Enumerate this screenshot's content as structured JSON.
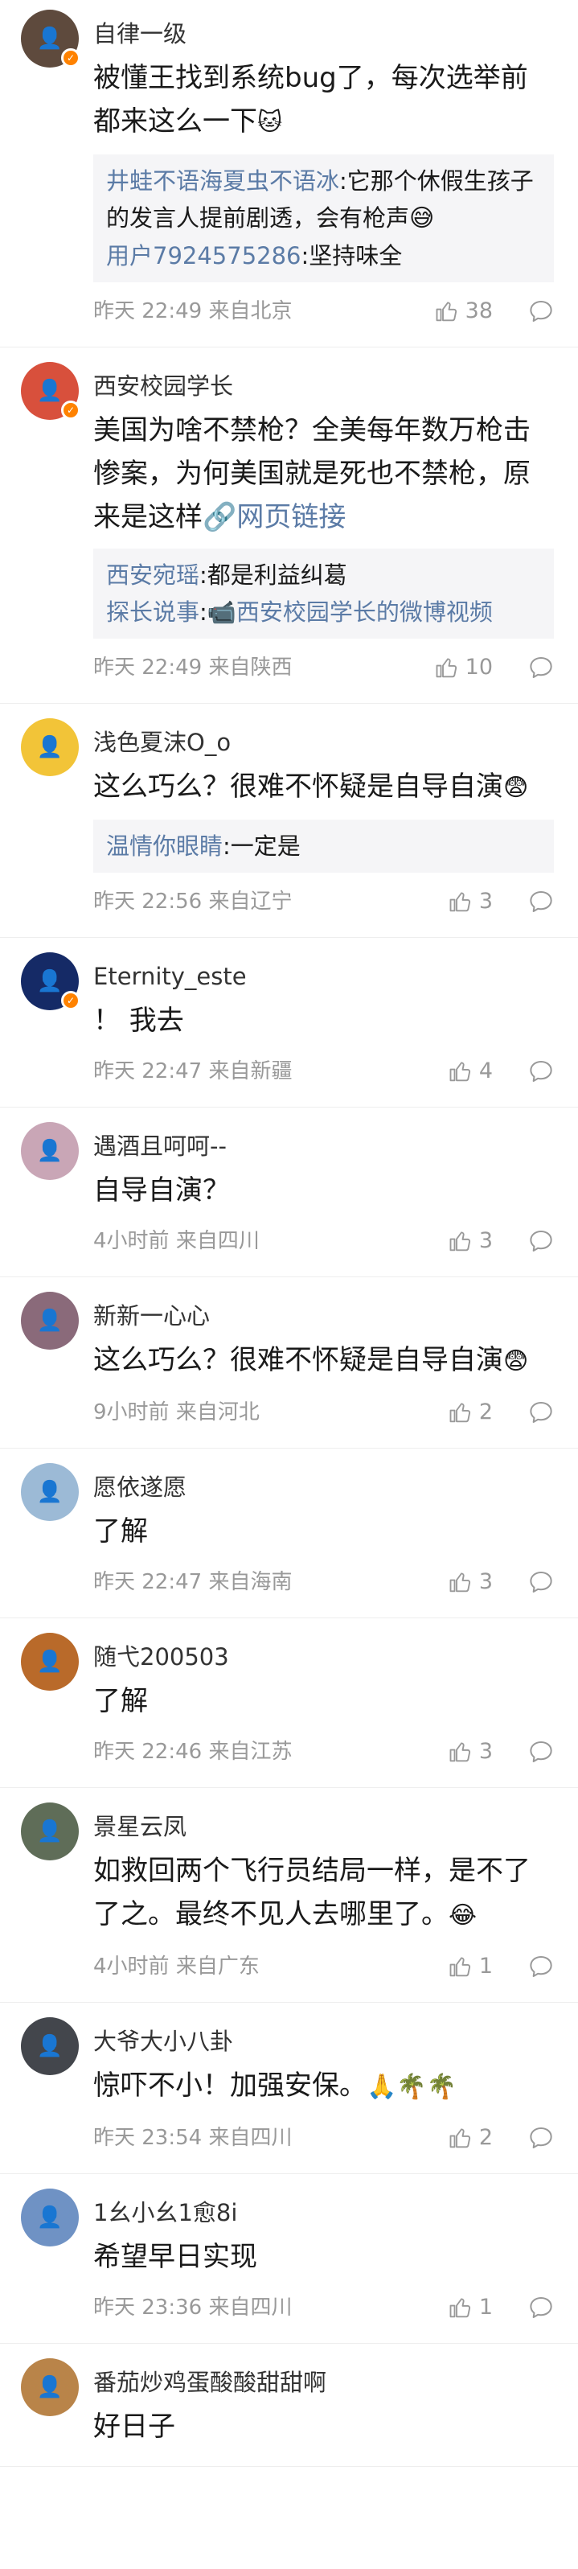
{
  "comments": [
    {
      "name": "自律一级",
      "avatar_color": "#5e4a3d",
      "badge": true,
      "text": "被懂王找到系统bug了，每次选举前都来这么一下",
      "emoji": "🐱",
      "replies": [
        {
          "who": "井蛙不语海夏虫不语冰",
          "text": "它那个休假生孩子的发言人提前剧透，会有枪声",
          "emoji": "😅"
        },
        {
          "who": "用户7924575286",
          "text": "坚持味全",
          "emoji": ""
        }
      ],
      "time": "昨天 22:49",
      "location": "来自北京",
      "likes": "38"
    },
    {
      "name": "西安校园学长",
      "avatar_color": "#d8503c",
      "badge": true,
      "text": "美国为啥不禁枪？全美每年数万枪击惨案，为何美国就是死也不禁枪，原来是这样",
      "link_icon": "🔗",
      "link": "网页链接",
      "replies": [
        {
          "who": "西安宛瑶",
          "text": "都是利益纠葛",
          "emoji": ""
        },
        {
          "who": "探长说事",
          "text": "",
          "video_icon": "📹",
          "video": "西安校园学长的微博视频"
        }
      ],
      "time": "昨天 22:49",
      "location": "来自陕西",
      "likes": "10"
    },
    {
      "name": "浅色夏沫O_o",
      "avatar_color": "#f2c438",
      "badge": false,
      "text": "这么巧么？很难不怀疑是自导自演",
      "emoji": "😨",
      "replies": [
        {
          "who": "温情你眼睛",
          "text": "一定是",
          "emoji": ""
        }
      ],
      "time": "昨天 22:56",
      "location": "来自辽宁",
      "likes": "3"
    },
    {
      "name": "Eternity_este",
      "avatar_color": "#152a66",
      "badge": true,
      "text": "！ 我去",
      "time": "昨天 22:47",
      "location": "来自新疆",
      "likes": "4"
    },
    {
      "name": "遇酒且呵呵--",
      "avatar_color": "#c9a6b6",
      "badge": false,
      "text": "自导自演？",
      "time": "4小时前",
      "location": "来自四川",
      "likes": "3"
    },
    {
      "name": "新新一心心",
      "avatar_color": "#8a6a7a",
      "badge": false,
      "text": "这么巧么？很难不怀疑是自导自演",
      "emoji": "😨",
      "time": "9小时前",
      "location": "来自河北",
      "likes": "2"
    },
    {
      "name": "愿依遂愿",
      "avatar_color": "#9cbad6",
      "badge": false,
      "text": "了解",
      "time": "昨天 22:47",
      "location": "来自海南",
      "likes": "3"
    },
    {
      "name": "随弋200503",
      "avatar_color": "#b96a2a",
      "badge": false,
      "text": "了解",
      "time": "昨天 22:46",
      "location": "来自江苏",
      "likes": "3"
    },
    {
      "name": "景星云凤",
      "avatar_color": "#5f6d58",
      "badge": false,
      "text": "如救回两个飞行员结局一样，是不了了之。最终不见人去哪里了。",
      "emoji": "😂",
      "time": "4小时前",
      "location": "来自广东",
      "likes": "1"
    },
    {
      "name": "大爷大小八卦",
      "avatar_color": "#43464c",
      "badge": false,
      "text": "惊吓不小！加强安保。",
      "emoji": "🙏🌴🌴",
      "time": "昨天 23:54",
      "location": "来自四川",
      "likes": "2"
    },
    {
      "name": "1幺小幺1愈8i",
      "avatar_color": "#6f92c4",
      "badge": false,
      "text": "希望早日实现",
      "time": "昨天 23:36",
      "location": "来自四川",
      "likes": "1"
    },
    {
      "name": "番茄炒鸡蛋酸酸甜甜啊",
      "avatar_color": "#b98449",
      "badge": false,
      "text": "好日子"
    }
  ]
}
